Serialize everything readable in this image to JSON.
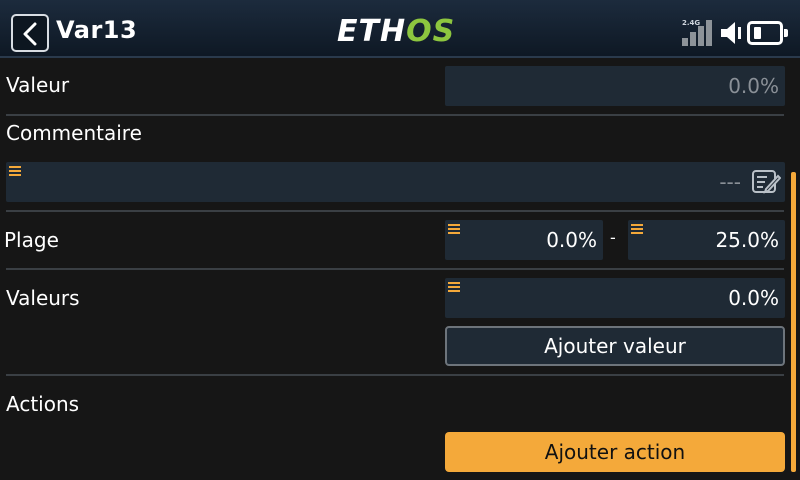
{
  "header": {
    "title": "Var13",
    "logo_left": "ETH",
    "logo_right": "OS",
    "radio_label": "2.4G",
    "icons": [
      "back-icon",
      "signal-icon",
      "speaker-icon",
      "battery-icon"
    ]
  },
  "fields": {
    "valeur": {
      "label": "Valeur",
      "value": "0.0%"
    },
    "commentaire": {
      "label": "Commentaire",
      "value": "---"
    },
    "plage": {
      "label": "Plage",
      "min": "0.0%",
      "separator": "-",
      "max": "25.0%"
    },
    "valeurs": {
      "label": "Valeurs",
      "value": "0.0%",
      "add_button": "Ajouter valeur"
    },
    "actions": {
      "label": "Actions",
      "add_button": "Ajouter action"
    }
  },
  "colors": {
    "accent": "#f4a93a",
    "logo_green": "#8dc63f",
    "field_bg": "#1f2a35",
    "background": "#161616"
  }
}
